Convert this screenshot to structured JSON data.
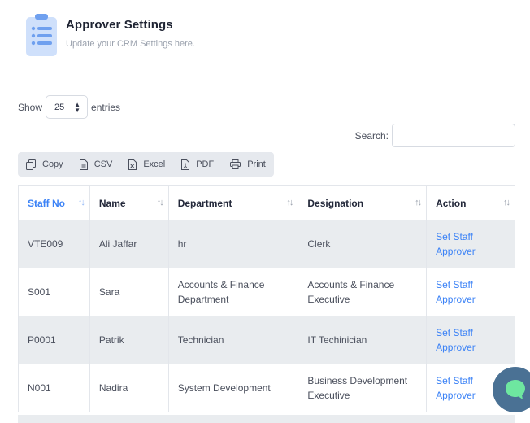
{
  "header": {
    "title": "Approver Settings",
    "subtitle": "Update your CRM Settings here.",
    "icon": "clipboard-list-icon"
  },
  "length_control": {
    "prefix": "Show",
    "value": "25",
    "suffix": "entries"
  },
  "search": {
    "label": "Search:",
    "value": "",
    "placeholder": ""
  },
  "toolbar": {
    "buttons": [
      {
        "label": "Copy",
        "icon": "copy-icon"
      },
      {
        "label": "CSV",
        "icon": "csv-file-icon"
      },
      {
        "label": "Excel",
        "icon": "excel-file-icon"
      },
      {
        "label": "PDF",
        "icon": "pdf-file-icon"
      },
      {
        "label": "Print",
        "icon": "printer-icon"
      }
    ]
  },
  "table": {
    "columns": [
      "Staff No",
      "Name",
      "Department",
      "Designation",
      "Action"
    ],
    "sorted_column": "Staff No",
    "rows": [
      {
        "staff_no": "VTE009",
        "name": "Ali Jaffar",
        "department": "hr",
        "designation": "Clerk",
        "action": "Set Staff Approver"
      },
      {
        "staff_no": "S001",
        "name": "Sara",
        "department": "Accounts & Finance Department",
        "designation": "Accounts & Finance Executive",
        "action": "Set Staff Approver"
      },
      {
        "staff_no": "P0001",
        "name": "Patrik",
        "department": "Technician",
        "designation": "IT Techinician",
        "action": "Set Staff Approver"
      },
      {
        "staff_no": "N001",
        "name": "Nadira",
        "department": "System Development",
        "designation": "Business Development Executive",
        "action": "Set Staff Approver"
      }
    ]
  },
  "chat_widget": {
    "icon": "chat-bubble-icon",
    "color": "#4a7194",
    "accent": "#6ee7a0"
  },
  "colors": {
    "link": "#3b82f6",
    "row_stripe": "#e9ecef",
    "toolbar_bg": "#e6e9ee"
  }
}
